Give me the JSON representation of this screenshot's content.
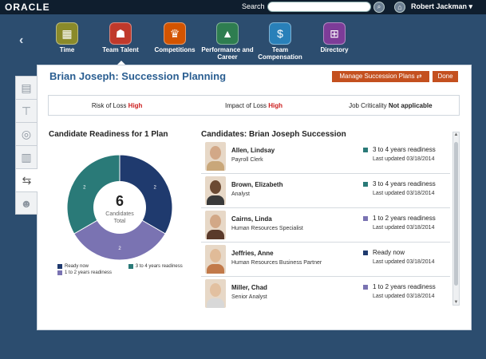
{
  "header": {
    "logo": "ORACLE",
    "search_label": "Search",
    "user_name": "Robert Jackman"
  },
  "apps": [
    {
      "label": "Time",
      "icon": "calendar-icon",
      "color": "#8a8a2a"
    },
    {
      "label": "Team Talent",
      "icon": "team-talent-icon",
      "color": "#c0392b"
    },
    {
      "label": "Competitions",
      "icon": "trophy-icon",
      "color": "#d35400"
    },
    {
      "label": "Performance and Career",
      "icon": "performance-icon",
      "color": "#2e7d50"
    },
    {
      "label": "Team Compensation",
      "icon": "compensation-icon",
      "color": "#2980b9"
    },
    {
      "label": "Directory",
      "icon": "directory-icon",
      "color": "#7d3c98"
    }
  ],
  "page": {
    "title": "Brian Joseph: Succession Planning",
    "manage_label": "Manage Succession Plans ⇄",
    "done_label": "Done"
  },
  "metrics": {
    "risk_label": "Risk of Loss",
    "risk_value": "High",
    "impact_label": "Impact of Loss",
    "impact_value": "High",
    "criticality_label": "Job Criticality",
    "criticality_value": "Not applicable"
  },
  "readiness": {
    "title": "Candidate Readiness for 1 Plan",
    "center_count": "6",
    "center_line1": "Candidates",
    "center_line2": "Total",
    "legend": {
      "ready_now": "Ready now",
      "three_four": "3 to 4 years readiness",
      "one_two": "1 to 2 years readiness"
    }
  },
  "chart_data": {
    "type": "pie",
    "categories": [
      "Ready now",
      "1 to 2 years readiness",
      "3 to 4 years readiness"
    ],
    "values": [
      2,
      2,
      2
    ],
    "colors": [
      "#1f3a6e",
      "#7a73b2",
      "#2a7a78"
    ]
  },
  "candidates_title": "Candidates: Brian Joseph Succession",
  "candidates": [
    {
      "name": "Allen, Lindsay",
      "title": "Payroll Clerk",
      "readiness": "3 to 4 years readiness",
      "updated": "Last updated 03/18/2014",
      "color": "#2a7a78"
    },
    {
      "name": "Brown, Elizabeth",
      "title": "Analyst",
      "readiness": "3 to 4 years readiness",
      "updated": "Last updated 03/18/2014",
      "color": "#2a7a78"
    },
    {
      "name": "Cairns, Linda",
      "title": "Human Resources Specialist",
      "readiness": "1 to 2 years readiness",
      "updated": "Last updated 03/18/2014",
      "color": "#7a73b2"
    },
    {
      "name": "Jeffries, Anne",
      "title": "Human Resources Business Partner",
      "readiness": "Ready now",
      "updated": "Last updated 03/18/2014",
      "color": "#1f3a6e"
    },
    {
      "name": "Miller, Chad",
      "title": "Senior Analyst",
      "readiness": "1 to 2 years readiness",
      "updated": "Last updated 03/18/2014",
      "color": "#7a73b2"
    }
  ]
}
